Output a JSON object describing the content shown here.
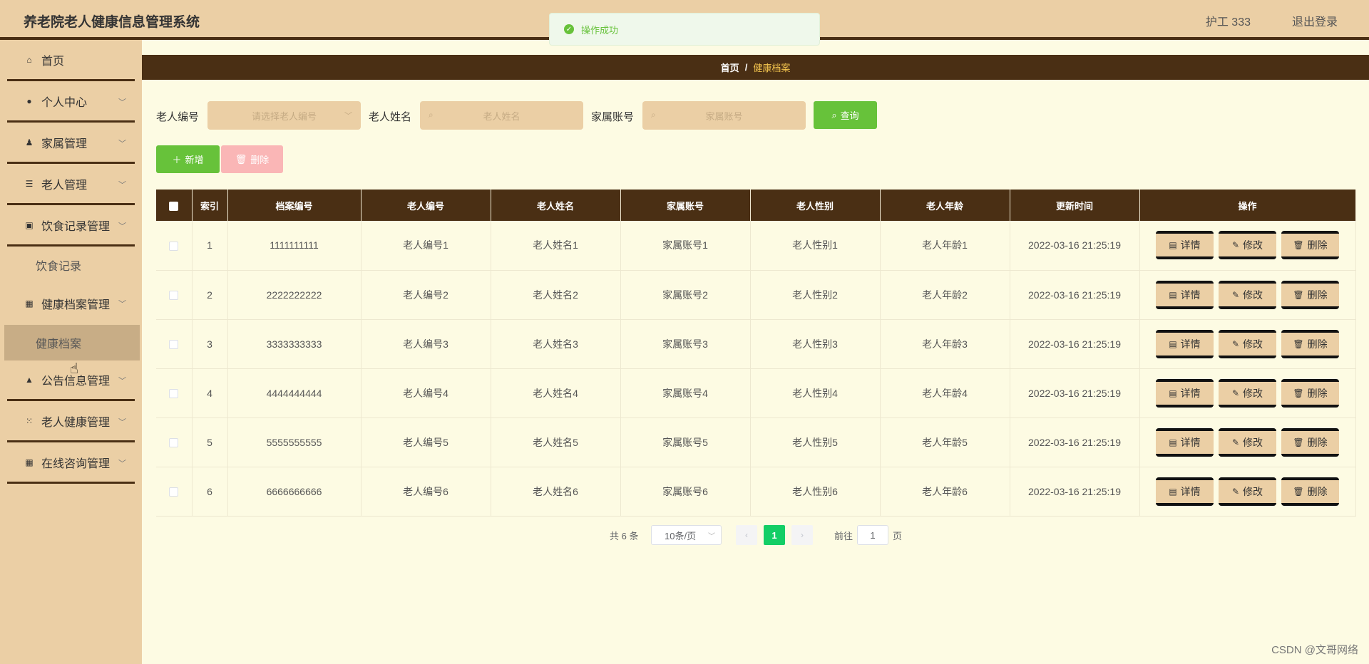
{
  "header": {
    "app_title": "养老院老人健康信息管理系统",
    "user": "护工 333",
    "logout": "退出登录"
  },
  "toast": {
    "message": "操作成功"
  },
  "sidebar": {
    "items": [
      {
        "label": "首页",
        "icon": "home-icon"
      },
      {
        "label": "个人中心",
        "icon": "user-icon"
      },
      {
        "label": "家属管理",
        "icon": "stamp-icon"
      },
      {
        "label": "老人管理",
        "icon": "list-icon"
      },
      {
        "label": "饮食记录管理",
        "icon": "chart-icon"
      },
      {
        "label": "健康档案管理",
        "icon": "grid-icon"
      },
      {
        "label": "公告信息管理",
        "icon": "badge-icon"
      },
      {
        "label": "老人健康管理",
        "icon": "apps-icon"
      },
      {
        "label": "在线咨询管理",
        "icon": "grid-icon"
      }
    ],
    "subs": [
      {
        "label": "饮食记录"
      },
      {
        "label": "健康档案"
      }
    ]
  },
  "breadcrumb": {
    "home": "首页",
    "separator": "/",
    "current": "健康档案"
  },
  "filters": {
    "elder_id_label": "老人编号",
    "elder_id_placeholder": "请选择老人编号",
    "elder_name_label": "老人姓名",
    "elder_name_placeholder": "老人姓名",
    "family_account_label": "家属账号",
    "family_account_placeholder": "家属账号",
    "query_label": "查询"
  },
  "actions": {
    "add_label": "新增",
    "delete_label": "删除"
  },
  "table": {
    "columns": [
      "索引",
      "档案编号",
      "老人编号",
      "老人姓名",
      "家属账号",
      "老人性别",
      "老人年龄",
      "更新时间",
      "操作"
    ],
    "rows": [
      [
        "1",
        "1111111111",
        "老人编号1",
        "老人姓名1",
        "家属账号1",
        "老人性别1",
        "老人年龄1",
        "2022-03-16 21:25:19"
      ],
      [
        "2",
        "2222222222",
        "老人编号2",
        "老人姓名2",
        "家属账号2",
        "老人性别2",
        "老人年龄2",
        "2022-03-16 21:25:19"
      ],
      [
        "3",
        "3333333333",
        "老人编号3",
        "老人姓名3",
        "家属账号3",
        "老人性别3",
        "老人年龄3",
        "2022-03-16 21:25:19"
      ],
      [
        "4",
        "4444444444",
        "老人编号4",
        "老人姓名4",
        "家属账号4",
        "老人性别4",
        "老人年龄4",
        "2022-03-16 21:25:19"
      ],
      [
        "5",
        "5555555555",
        "老人编号5",
        "老人姓名5",
        "家属账号5",
        "老人性别5",
        "老人年龄5",
        "2022-03-16 21:25:19"
      ],
      [
        "6",
        "6666666666",
        "老人编号6",
        "老人姓名6",
        "家属账号6",
        "老人性别6",
        "老人年龄6",
        "2022-03-16 21:25:19"
      ]
    ],
    "row_actions": {
      "detail": "详情",
      "edit": "修改",
      "delete": "删除"
    }
  },
  "pagination": {
    "total_text": "共 6 条",
    "page_size": "10条/页",
    "current_page": "1",
    "goto_label": "前往",
    "goto_value": "1",
    "page_suffix": "页"
  },
  "watermark": "CSDN @文哥网络",
  "colors": {
    "accent_dark": "#4a2f14",
    "sidebar_bg": "#ebcfa5",
    "content_bg": "#fdfbe3",
    "success": "#67c23a",
    "current_page": "#13ce66",
    "breadcrumb_current": "#f3c44e"
  }
}
